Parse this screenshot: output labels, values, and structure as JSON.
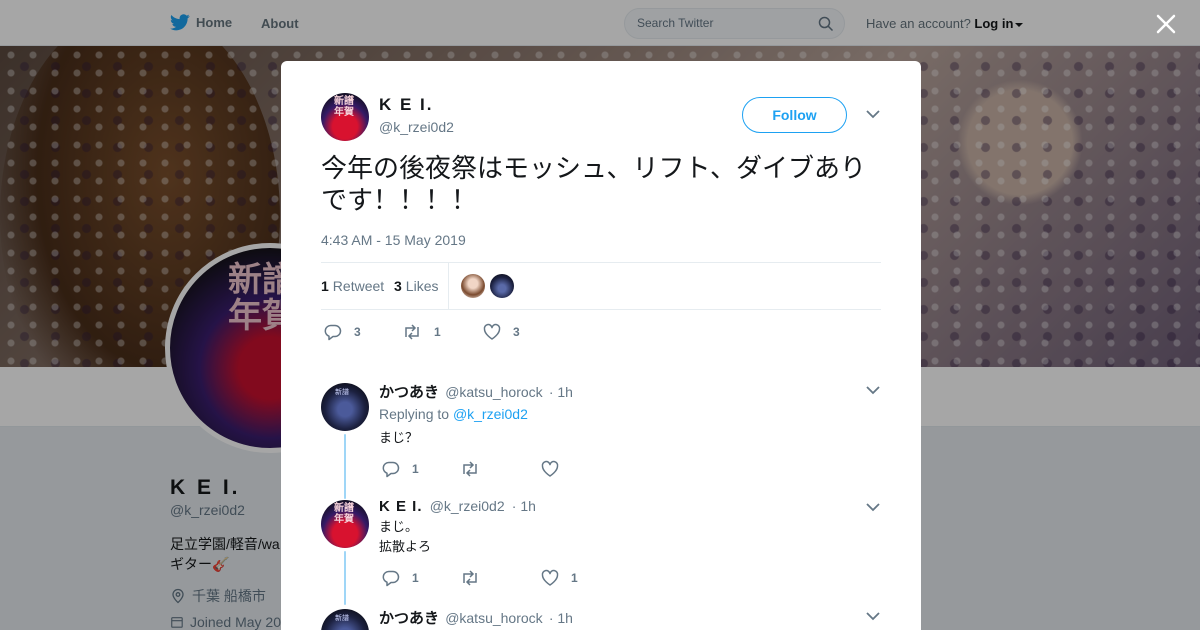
{
  "nav": {
    "home_label": "Home",
    "about_label": "About",
    "search_placeholder": "Search Twitter",
    "account_prompt": "Have an account?",
    "login_label": "Log in"
  },
  "profile": {
    "avatar_text": "新譜\n年賀",
    "name": "K E I.",
    "handle": "@k_rzei0d2",
    "bio_line1": "足立学園/軽音/wa",
    "bio_line2": "ギター🎸",
    "location": "千葉 船橋市",
    "joined": "Joined May 20"
  },
  "tweet": {
    "author_name": "K E I.",
    "author_handle": "@k_rzei0d2",
    "follow_label": "Follow",
    "text": "今年の後夜祭はモッシュ、リフト、ダイブありです！！！！",
    "timestamp": "4:43 AM - 15 May 2019",
    "retweets_count": "1",
    "retweets_label": "Retweet",
    "likes_count": "3",
    "likes_label": "Likes",
    "actions": {
      "replies": "3",
      "retweets": "1",
      "likes": "3"
    }
  },
  "replies": [
    {
      "name": "かつあき",
      "handle": "@katsu_horock",
      "time": "· 1h",
      "replying_prefix": "Replying to",
      "replying_to": "@k_rzei0d2",
      "text": "まじ？",
      "replies": "1",
      "retweets": "",
      "likes": ""
    },
    {
      "name": "K E I.",
      "handle": "@k_rzei0d2",
      "time": "· 1h",
      "text_line1": "まじ。",
      "text_line2": "拡散よろ",
      "replies": "1",
      "retweets": "",
      "likes": "1"
    },
    {
      "name": "かつあき",
      "handle": "@katsu_horock",
      "time": "· 1h"
    }
  ],
  "colors": {
    "accent": "#1da1f2",
    "text": "#14171a",
    "muted": "#657786"
  }
}
